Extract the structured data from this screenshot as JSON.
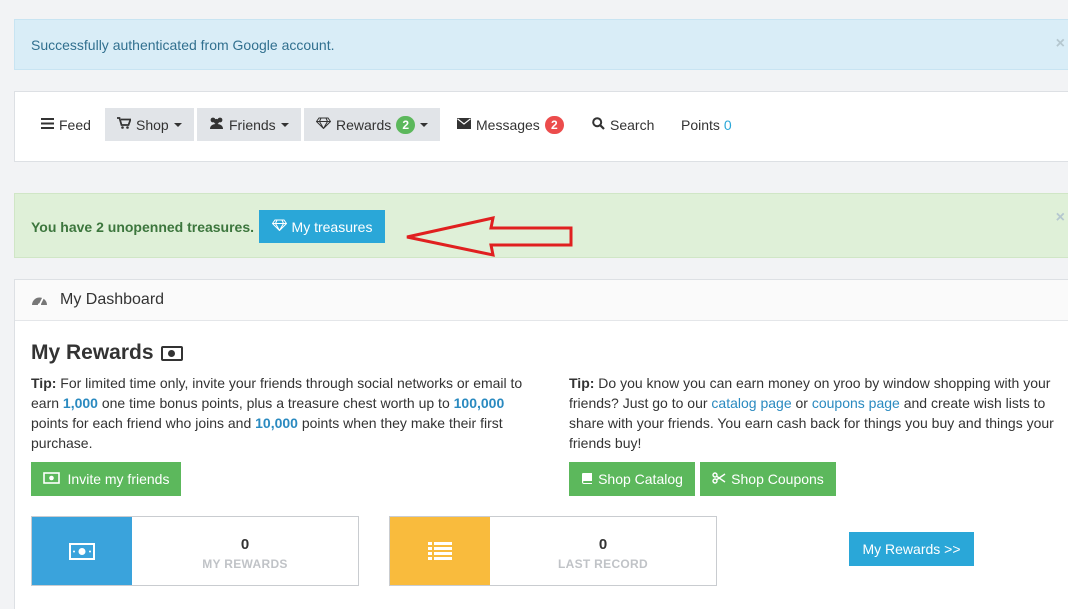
{
  "alert_auth": {
    "message": "Successfully authenticated from Google account.",
    "close": "×"
  },
  "nav": {
    "feed": "Feed",
    "shop": "Shop",
    "friends": "Friends",
    "rewards": "Rewards",
    "rewards_badge": "2",
    "messages": "Messages",
    "messages_badge": "2",
    "search": "Search",
    "points_label": "Points",
    "points_value": "0"
  },
  "alert_treasure": {
    "message": "You have 2 unopenned treasures.",
    "button": "My treasures",
    "close": "×"
  },
  "dashboard": {
    "header": "My Dashboard",
    "title": "My Rewards",
    "tip_left": {
      "label": "Tip:",
      "t1": " For limited time only, invite your friends through social networks or email to earn ",
      "v1": "1,000",
      "t2": " one time bonus points, plus a treasure chest worth up to ",
      "v2": "100,000",
      "t3": " points for each friend who joins and ",
      "v3": "10,000",
      "t4": " points when they make their first purchase."
    },
    "tip_right": {
      "label": "Tip:",
      "t1": " Do you know you can earn money on yroo by window shopping with your friends? Just go to our ",
      "link1": "catalog page",
      "t2": " or ",
      "link2": "coupons page",
      "t3": " and create wish lists to share with your friends. You earn cash back for things you buy and things your friends buy!"
    },
    "invite_button": "Invite my friends",
    "shop_catalog_button": "Shop Catalog",
    "shop_coupons_button": "Shop Coupons",
    "stats": [
      {
        "value": "0",
        "label": "MY REWARDS",
        "color": "#3aa3dc"
      },
      {
        "value": "0",
        "label": "LAST RECORD",
        "color": "#f9bb3d"
      }
    ],
    "my_rewards_button": "My Rewards >>"
  },
  "colors": {
    "accent_blue": "#2aa7d8",
    "green": "#5cb85c",
    "annotation_arrow": "#e02020"
  }
}
